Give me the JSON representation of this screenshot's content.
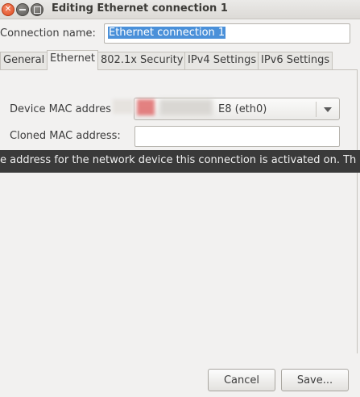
{
  "window": {
    "title": "Editing Ethernet connection 1",
    "controls": [
      "close-icon",
      "minimize-icon",
      "maximize-icon"
    ]
  },
  "connection": {
    "label": "Connection name:",
    "value": "Ethernet connection 1"
  },
  "tabs": [
    {
      "label": "General"
    },
    {
      "label": "Ethernet",
      "active": true
    },
    {
      "label": "802.1x Security"
    },
    {
      "label": "IPv4 Settings"
    },
    {
      "label": "IPv6 Settings"
    }
  ],
  "ethernet": {
    "device_mac_label": "Device MAC addres",
    "device_mac_value": "E8 (eth0)",
    "cloned_mac_label": "Cloned MAC address:",
    "cloned_mac_value": ""
  },
  "tooltip": {
    "text": "e address for the network device this connection is activated on.  Th"
  },
  "buttons": {
    "cancel": "Cancel",
    "save": "Save..."
  },
  "colors": {
    "accent": "#4a90d9",
    "close": "#df4a1e",
    "tooltip_bg": "#3a3a3a"
  }
}
